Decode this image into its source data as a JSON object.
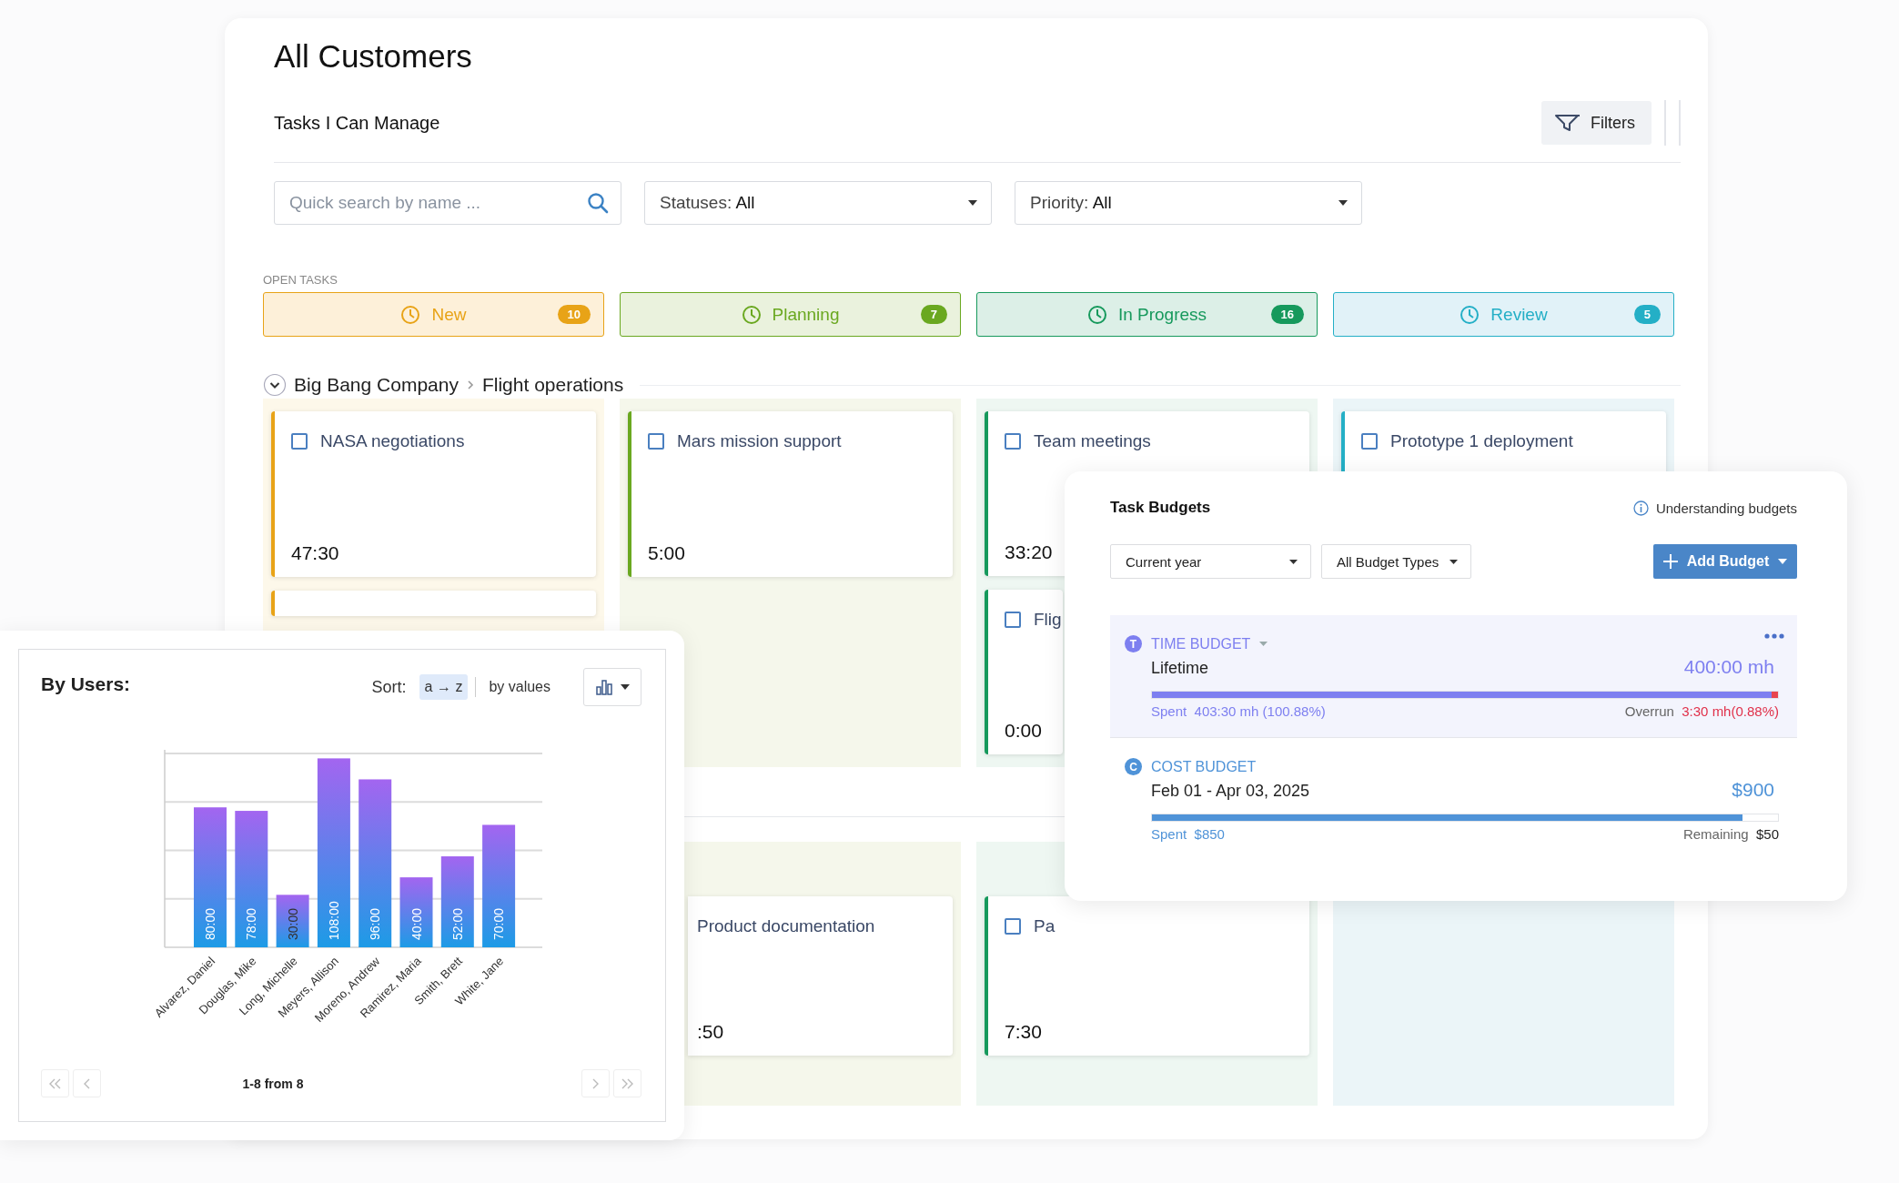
{
  "header": {
    "title": "All Customers",
    "subtitle": "Tasks I Can Manage",
    "filters_button": "Filters"
  },
  "search": {
    "placeholder": "Quick search by name ..."
  },
  "dropdowns": [
    {
      "label": "Statuses:",
      "value": "All"
    },
    {
      "label": "Priority:",
      "value": "All"
    }
  ],
  "open_tasks": {
    "heading": "OPEN TASKS",
    "statuses": [
      {
        "name": "New",
        "count": "10",
        "color": "#e8a317"
      },
      {
        "name": "Planning",
        "count": "7",
        "color": "#6aa820"
      },
      {
        "name": "In Progress",
        "count": "16",
        "color": "#16995c"
      },
      {
        "name": "Review",
        "count": "5",
        "color": "#24afc6"
      }
    ]
  },
  "groups": [
    {
      "breadcrumb": {
        "expanded": true,
        "items": [
          "Big Bang Company",
          "Flight operations"
        ]
      },
      "columns": [
        {
          "cards": [
            {
              "kind": "task",
              "title": "NASA negotiations",
              "time": "47:30",
              "checked": false
            },
            {
              "kind": "stub"
            }
          ]
        },
        {
          "cards": [
            {
              "kind": "task",
              "title": "Mars mission support",
              "time": "5:00",
              "checked": false
            }
          ]
        },
        {
          "cards": [
            {
              "kind": "task",
              "title": "Team meetings",
              "time": "33:20",
              "checked": false
            },
            {
              "kind": "clipped",
              "title": "Flig",
              "time": "0:00",
              "checked": false
            }
          ]
        },
        {
          "cards": [
            {
              "kind": "task",
              "title": "Prototype 1 deployment",
              "checked": false
            }
          ]
        }
      ]
    },
    {
      "columns": [
        {},
        {
          "cards": [
            {
              "kind": "cut",
              "title": "Product documentation",
              "time": ":50"
            }
          ]
        },
        {
          "cards": [
            {
              "kind": "task",
              "title": "Pa",
              "time": "7:30",
              "checked": false
            }
          ]
        },
        {}
      ]
    }
  ],
  "users_panel": {
    "title": "By Users:",
    "sort_label": "Sort:",
    "sort_options": [
      {
        "label": "a → z",
        "selected": true
      },
      {
        "label": "by values",
        "selected": false
      }
    ],
    "pagination": "1-8 from 8",
    "chart_data": {
      "type": "bar",
      "categories": [
        "Alvarez, Daniel",
        "Douglas, Mike",
        "Long, Michelle",
        "Meyers, Allison",
        "Moreno, Andrew",
        "Ramirez, Maria",
        "Smith, Brett",
        "White, Jane"
      ],
      "values": [
        80,
        78,
        30,
        108,
        96,
        40,
        52,
        70
      ],
      "value_labels": [
        "80:00",
        "78:00",
        "30:00",
        "108:00",
        "96:00",
        "40:00",
        "52:00",
        "70:00"
      ],
      "ylim": [
        0,
        110.8
      ]
    }
  },
  "budgets_panel": {
    "title": "Task Budgets",
    "help_link": "Understanding budgets",
    "filters": [
      "Current year",
      "All Budget Types"
    ],
    "add_button": "Add Budget",
    "items": [
      {
        "kind": "time",
        "badge": "T",
        "label": "TIME BUDGET",
        "expandable": true,
        "period": "Lifetime",
        "amount": "400:00 mh",
        "level": 0.99,
        "overrun": true,
        "spent_label": "Spent",
        "spent": "403:30 mh  (100.88%)",
        "rest_label": "Overrun",
        "rest": "3:30 mh(0.88%)",
        "color": "#7d7ff0"
      },
      {
        "kind": "cost",
        "badge": "C",
        "label": "COST BUDGET",
        "period": "Feb 01 - Apr 03, 2025",
        "amount": "$900",
        "level": 0.944,
        "overrun": false,
        "spent_label": "Spent",
        "spent": "$850",
        "rest_label": "Remaining",
        "rest": "$50",
        "color": "#4f93d8"
      }
    ]
  }
}
